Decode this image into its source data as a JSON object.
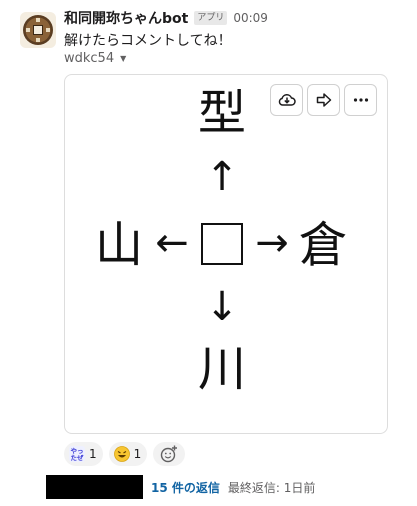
{
  "message": {
    "bot_name": "和同開珎ちゃんbot",
    "app_badge": "アプリ",
    "timestamp": "00:09",
    "text": "解けたらコメントしてね！",
    "file_name": "wdkc54"
  },
  "puzzle": {
    "top": "型",
    "left": "山",
    "right": "倉",
    "bottom": "川",
    "arrow_up": "↑",
    "arrow_left": "←",
    "arrow_right": "→",
    "arrow_down": "↓"
  },
  "reactions": [
    {
      "emoji": "yatta",
      "count": "1"
    },
    {
      "emoji": "rolling-on-floor-laughing",
      "count": "1"
    }
  ],
  "thread": {
    "reply_count": "15 件の返信",
    "last_reply": "最終返信: 1日前"
  },
  "colors": {
    "link": "#1264a3",
    "muted": "#616061",
    "text": "#1d1c1d"
  }
}
